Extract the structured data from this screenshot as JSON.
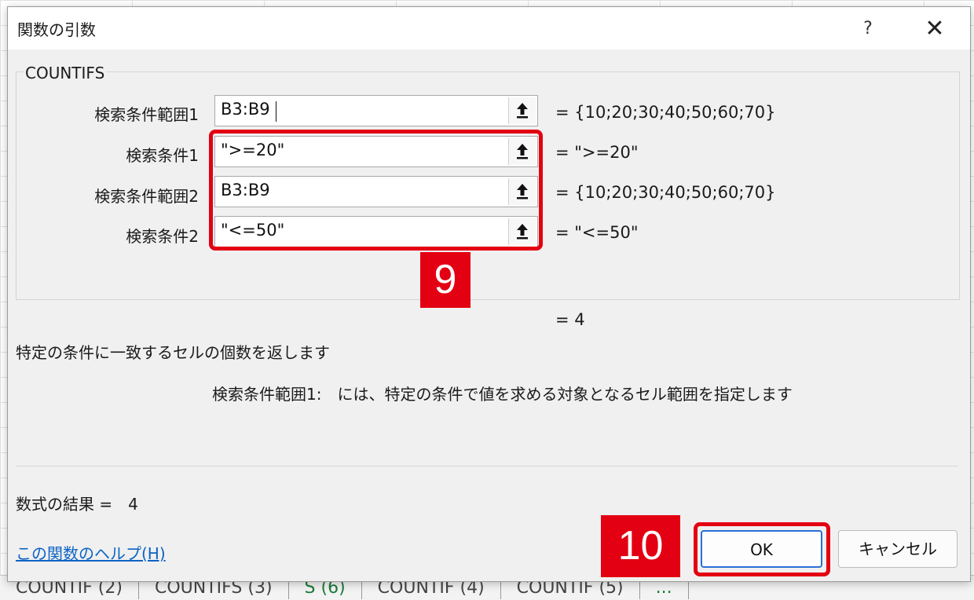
{
  "dialog": {
    "title": "関数の引数",
    "help_label": "?",
    "close_label": "✕"
  },
  "function_name": "COUNTIFS",
  "arguments": [
    {
      "label": "検索条件範囲1",
      "value": "B3:B9",
      "result": "= {10;20;30;40;50;60;70}"
    },
    {
      "label": "検索条件1",
      "value": "\">=20\"",
      "result": "= \">=20\""
    },
    {
      "label": "検索条件範囲2",
      "value": "B3:B9",
      "result": "= {10;20;30;40;50;60;70}"
    },
    {
      "label": "検索条件2",
      "value": "\"<=50\"",
      "result": "= \"<=50\""
    }
  ],
  "formula_value": "=  4",
  "description": "特定の条件に一致するセルの個数を返します",
  "argument_description": "検索条件範囲1:　には、特定の条件で値を求める対象となるセル範囲を指定します",
  "formula_result": "数式の結果 =　4",
  "help_link": "この関数のヘルプ(H)",
  "buttons": {
    "ok": "OK",
    "cancel": "キャンセル"
  },
  "annotations": {
    "step9": "9",
    "step10": "10"
  },
  "sheet_tabs": [
    "COUNTIF (2)",
    "COUNTIFS (3)",
    "S (6)",
    "COUNTIF (4)",
    "COUNTIF (5)",
    "..."
  ],
  "colors": {
    "annotation_red": "#e30012",
    "link_blue": "#0b63c4",
    "focus_blue": "#2a6fd6"
  }
}
